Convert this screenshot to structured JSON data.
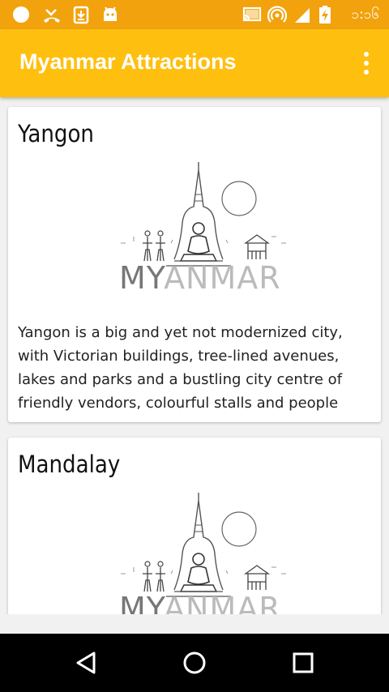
{
  "status_bar": {
    "time": "၁:၁၆",
    "icons": [
      "circle-notification-icon",
      "missed-call-icon",
      "download-icon",
      "android-icon",
      "cast-icon",
      "hotspot-icon",
      "signal-icon",
      "battery-charging-icon"
    ]
  },
  "app_bar": {
    "title": "Myanmar Attractions",
    "menu_icon": "more-vert-icon"
  },
  "cards": [
    {
      "title": "Yangon",
      "logo_text_dark": "MY",
      "logo_text_light": "ANMAR",
      "description": "Yangon is a big and yet not modernized city, with Victorian buildings, tree-lined avenues, lakes and parks and a bustling city centre of friendly vendors, colourful stalls and people"
    },
    {
      "title": "Mandalay",
      "logo_text_dark": "MY",
      "logo_text_light": "ANMAR"
    }
  ],
  "nav_bar": {
    "buttons": [
      "back-icon",
      "home-icon",
      "recents-icon"
    ]
  },
  "colors": {
    "status_bar": "#f2a20c",
    "app_bar": "#ffbf0f",
    "nav_bar": "#000000",
    "background": "#f1f1f1"
  }
}
